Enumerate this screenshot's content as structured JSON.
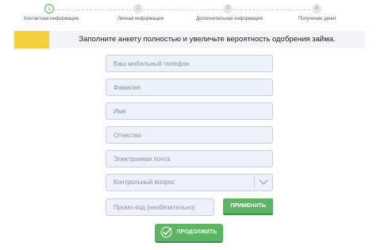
{
  "stepper": {
    "steps": [
      {
        "number": "1",
        "label": "Контактная информация",
        "state": "active"
      },
      {
        "number": "2",
        "label": "Личная информация",
        "state": "inactive"
      },
      {
        "number": "3",
        "label": "Дополнительная информация",
        "state": "inactive"
      },
      {
        "number": "4",
        "label": "Получение денег",
        "state": "inactive"
      }
    ]
  },
  "banner": {
    "text": "Заполните анкету полностью и увеличьте вероятность одобрения займа."
  },
  "form": {
    "phone_placeholder": "Ваш мобильный телефон",
    "lastname_placeholder": "Фамилия",
    "firstname_placeholder": "Имя",
    "patronymic_placeholder": "Отчество",
    "email_placeholder": "Электронная почта",
    "security_question": "Контрольный вопрос",
    "promo_placeholder": "Промо-код (необязательно)",
    "apply_label": "ПРИМЕНИТЬ",
    "continue_label": "ПРОДОЛЖИТЬ"
  },
  "colors": {
    "accent_green": "#5bb563",
    "banner_accent": "#f6d03a",
    "input_bg": "#edf1fb"
  },
  "icons": {
    "select": "chevron-down-icon",
    "continue": "check-circle-icon"
  }
}
